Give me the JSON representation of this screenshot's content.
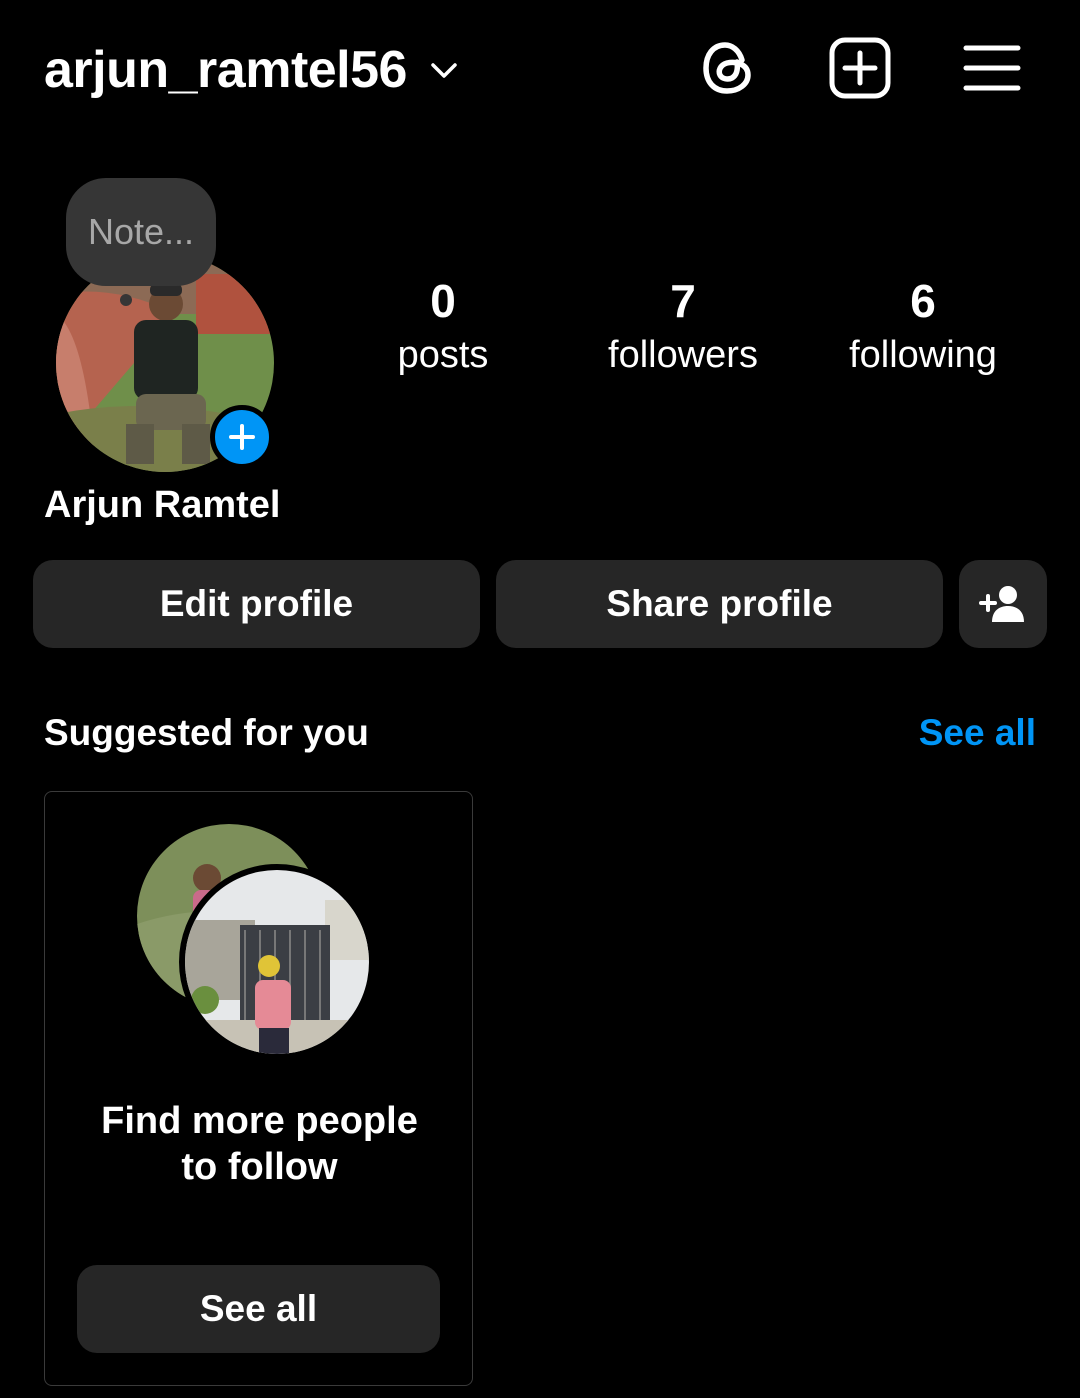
{
  "header": {
    "username": "arjun_ramtel56",
    "icons": [
      "chevron-down-icon",
      "threads-icon",
      "new-post-icon",
      "menu-icon"
    ]
  },
  "profile": {
    "note_placeholder": "Note...",
    "display_name": "Arjun Ramtel",
    "stats": {
      "posts": {
        "value": "0",
        "label": "posts"
      },
      "followers": {
        "value": "7",
        "label": "followers"
      },
      "following": {
        "value": "6",
        "label": "following"
      }
    }
  },
  "actions": {
    "edit_profile": "Edit profile",
    "share_profile": "Share profile",
    "discover_people_icon": "add-person-icon"
  },
  "suggested": {
    "title": "Suggested for you",
    "see_all_link": "See all",
    "card": {
      "text_line1": "Find more people",
      "text_line2": "to follow",
      "button": "See all"
    }
  },
  "colors": {
    "background": "#000000",
    "button_bg": "#262626",
    "accent_blue": "#0095f6",
    "note_bg": "#363636"
  }
}
